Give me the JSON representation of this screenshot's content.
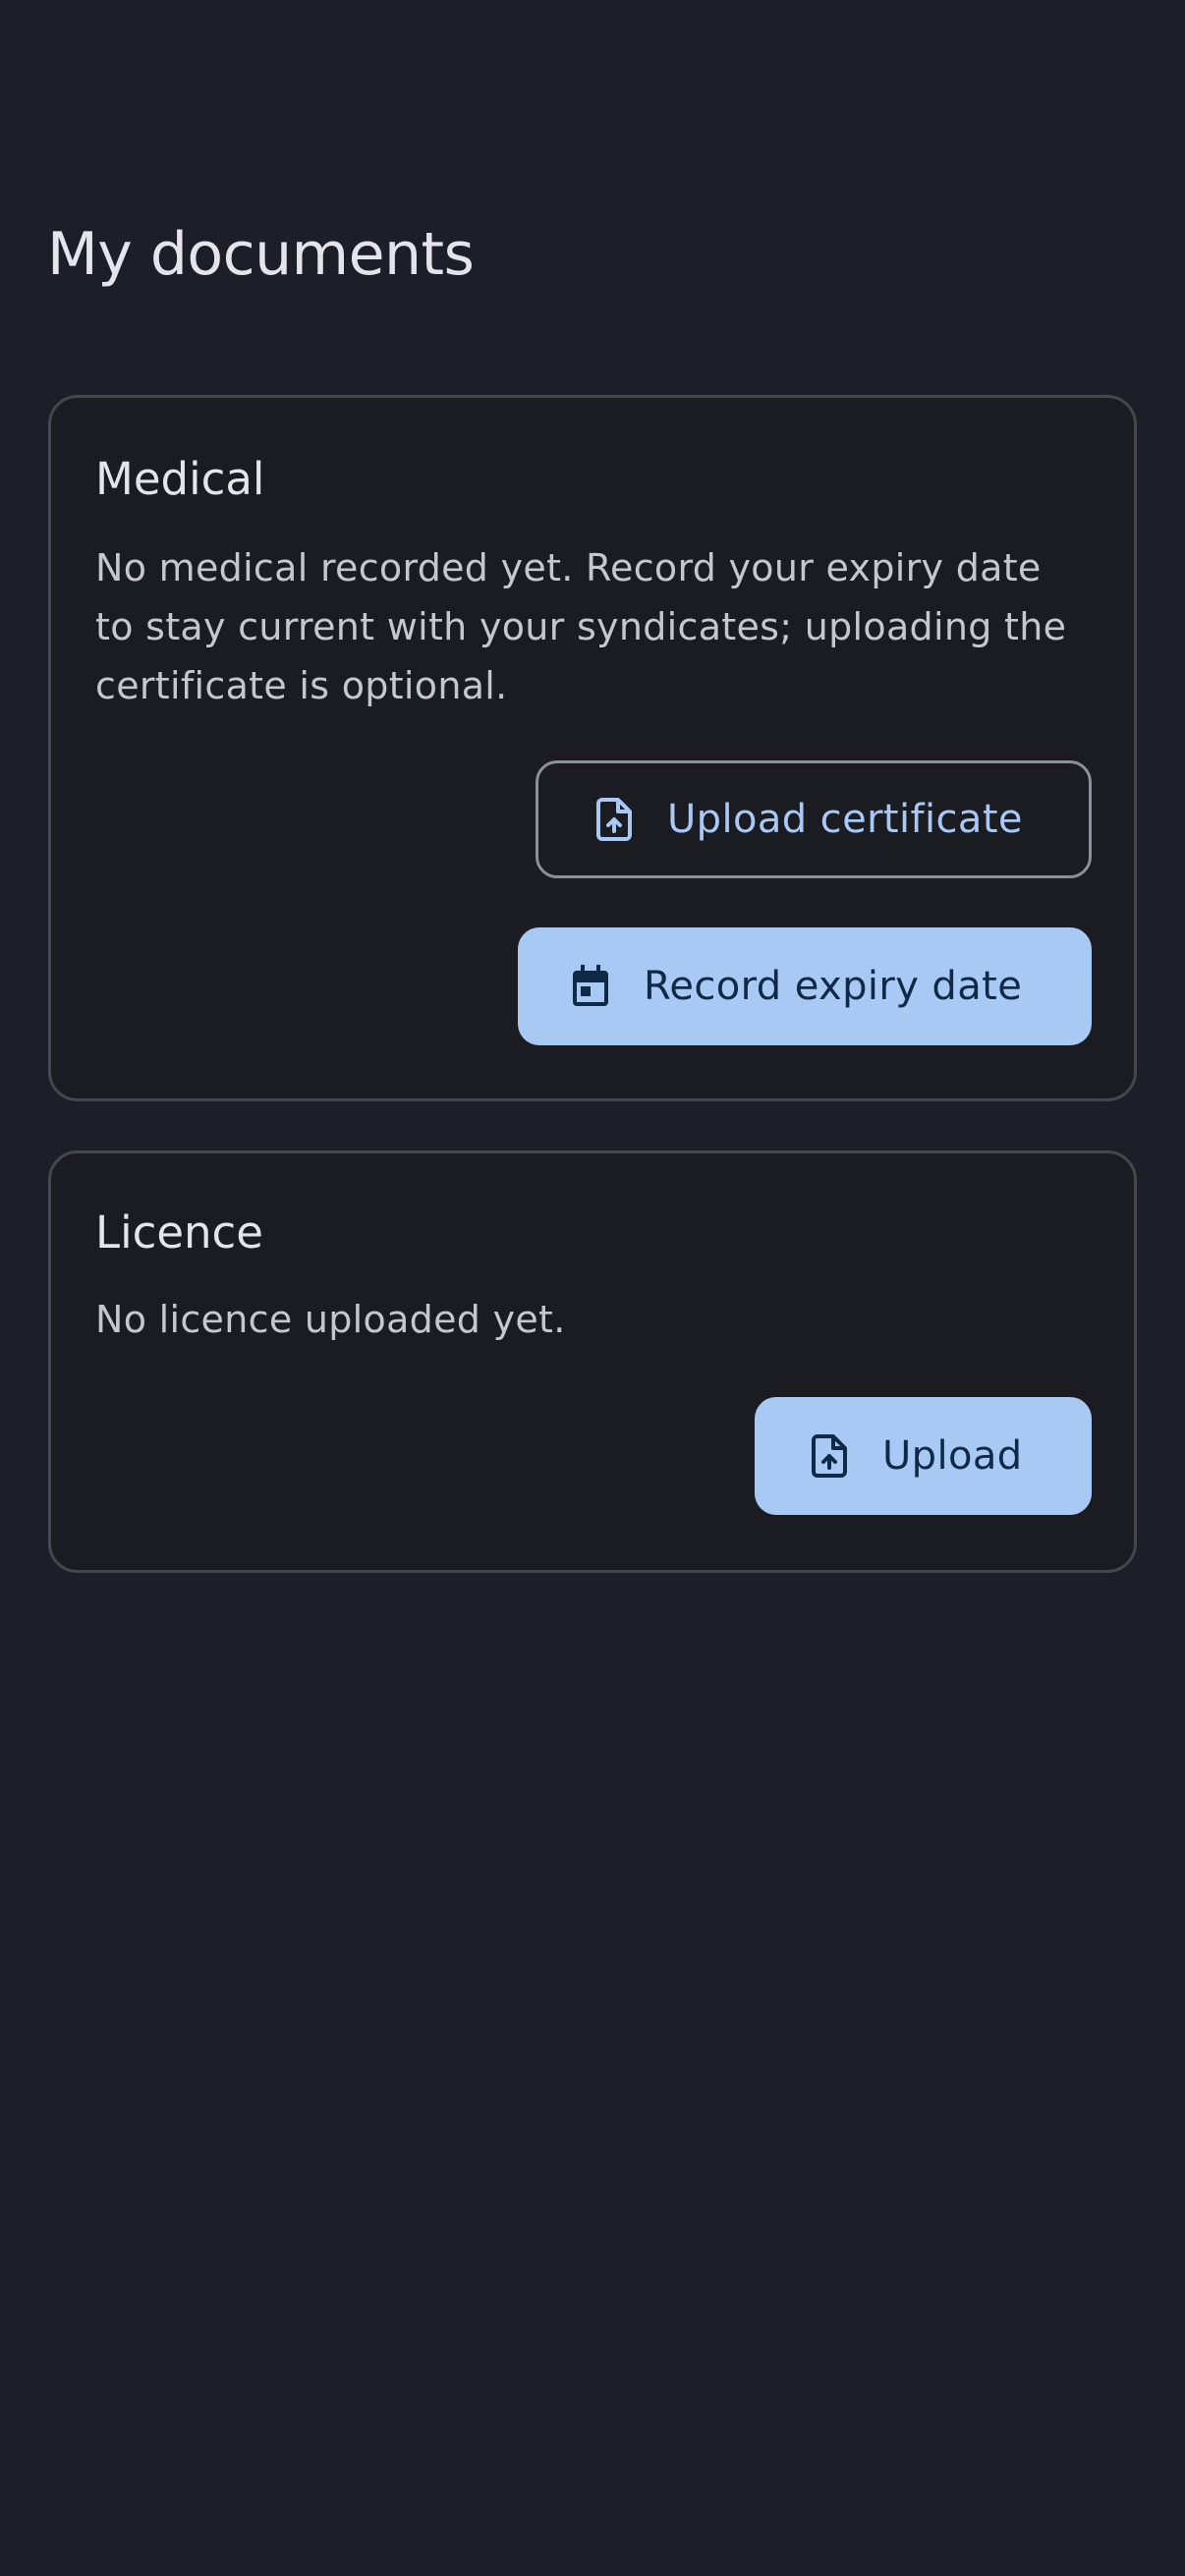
{
  "page": {
    "title": "My documents"
  },
  "medical": {
    "title": "Medical",
    "description": "No medical recorded yet. Record your expiry date to stay current with your syndicates; uploading the certificate is optional.",
    "upload_certificate_label": "Upload certificate",
    "upload_certificate_icon": "file-upload-icon",
    "record_expiry_label": "Record expiry date",
    "record_expiry_icon": "calendar-icon"
  },
  "licence": {
    "title": "Licence",
    "description": "No licence uploaded yet.",
    "upload_label": "Upload",
    "upload_icon": "file-upload-icon"
  },
  "colors": {
    "background": "#1d1f28",
    "card_background": "#1a1c21",
    "card_border": "#45474d",
    "accent": "#a9c9f5",
    "accent_text": "#0f2a47"
  }
}
